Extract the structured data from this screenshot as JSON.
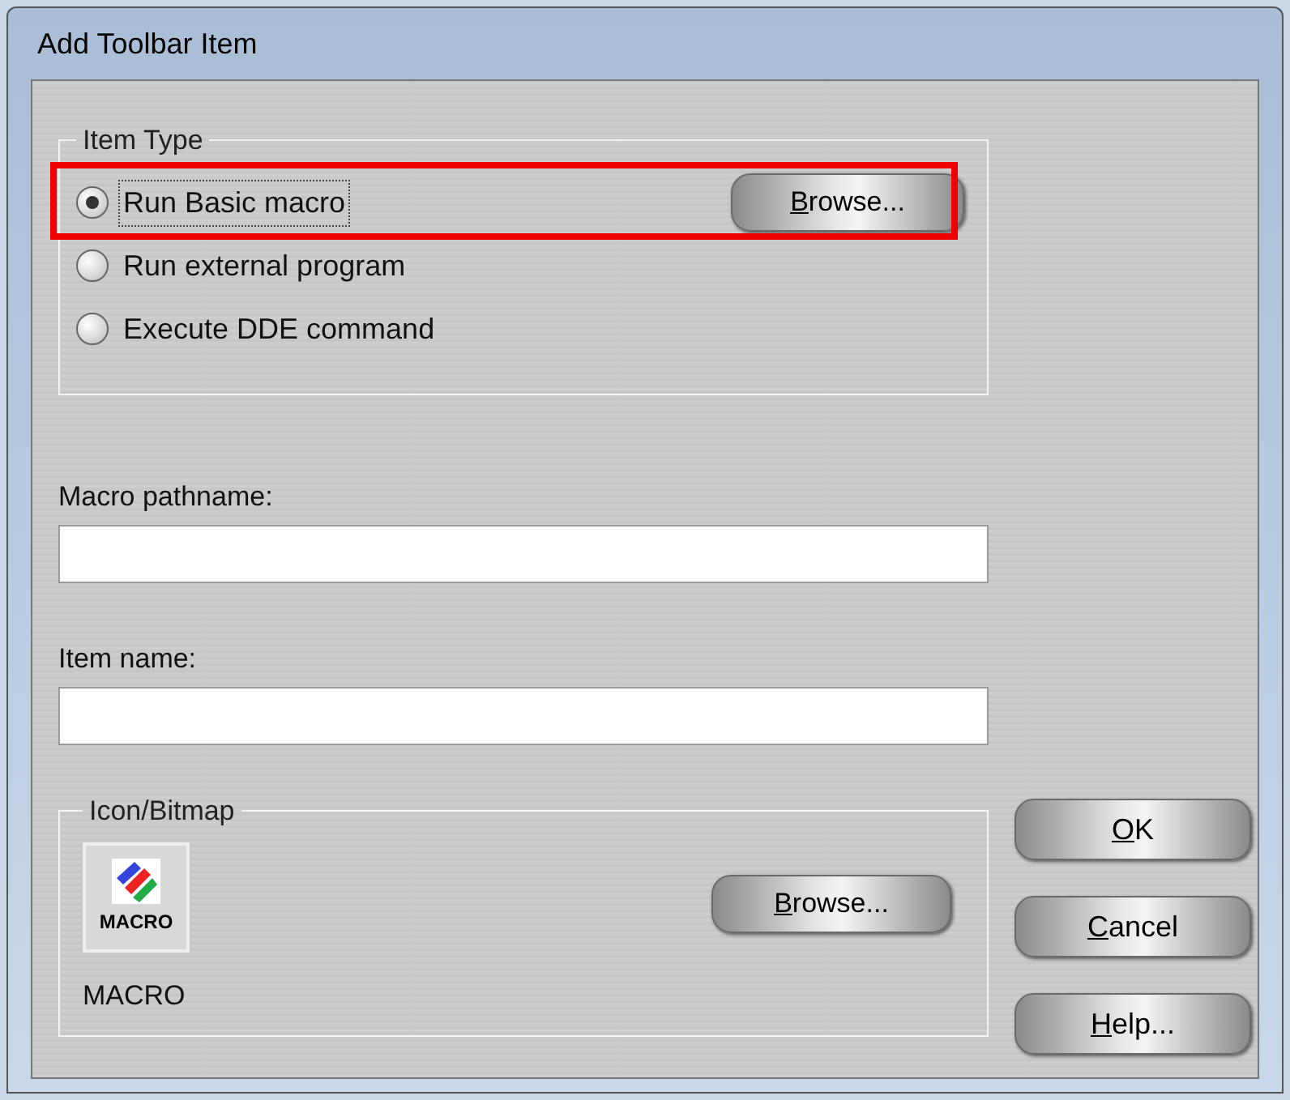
{
  "window": {
    "title": "Add Toolbar Item"
  },
  "item_type": {
    "legend": "Item Type",
    "options": [
      {
        "label": "Run Basic macro",
        "selected": true,
        "focused": true
      },
      {
        "label": "Run external program",
        "selected": false,
        "focused": false
      },
      {
        "label": "Execute DDE command",
        "selected": false,
        "focused": false
      }
    ],
    "browse_button": {
      "access_key": "B",
      "label_rest": "rowse..."
    },
    "highlighted": true
  },
  "fields": [
    {
      "label": "Macro pathname:"
    },
    {
      "label": "Item name:"
    }
  ],
  "icon_bitmap": {
    "legend": "Icon/Bitmap",
    "icon_caption": "MACRO",
    "name": "MACRO",
    "browse_button": {
      "access_key": "B",
      "label_rest": "rowse..."
    }
  },
  "buttons": [
    {
      "access_key": "O",
      "label_rest": "K"
    },
    {
      "access_key": "C",
      "label_rest": "ancel"
    },
    {
      "access_key": "H",
      "label_rest": "elp..."
    }
  ]
}
